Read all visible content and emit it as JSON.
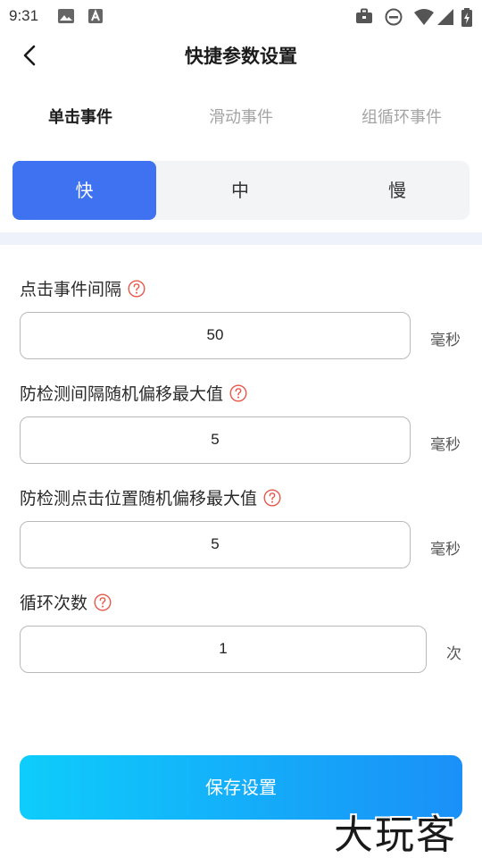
{
  "status_bar": {
    "time": "9:31",
    "icons": [
      "image-icon",
      "font-icon",
      "briefcase-icon",
      "do-not-disturb-icon",
      "wifi-icon",
      "signal-icon",
      "battery-icon"
    ]
  },
  "header": {
    "title": "快捷参数设置",
    "back_icon": "chevron-left-icon"
  },
  "tabs": [
    {
      "label": "单击事件",
      "active": true
    },
    {
      "label": "滑动事件",
      "active": false
    },
    {
      "label": "组循环事件",
      "active": false
    }
  ],
  "speed": {
    "options": [
      "快",
      "中",
      "慢"
    ],
    "selected": "快"
  },
  "fields": [
    {
      "label": "点击事件间隔",
      "value": "50",
      "unit": "毫秒"
    },
    {
      "label": "防检测间隔随机偏移最大值",
      "value": "5",
      "unit": "毫秒"
    },
    {
      "label": "防检测点击位置随机偏移最大值",
      "value": "5",
      "unit": "毫秒"
    },
    {
      "label": "循环次数",
      "value": "1",
      "unit": "次"
    }
  ],
  "save_label": "保存设置",
  "watermark": "大玩客",
  "colors": {
    "accent": "#3f72f0",
    "help_icon": "#e8574b",
    "save_gradient_start": "#0ecdfb",
    "save_gradient_end": "#1a90f8",
    "divider": "#eef3fb"
  }
}
